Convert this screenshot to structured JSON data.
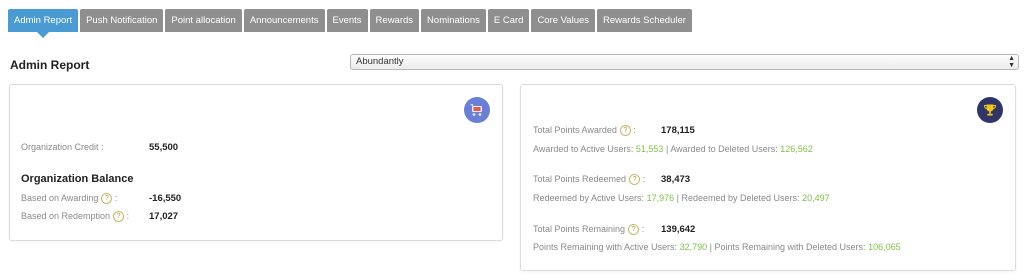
{
  "tabs": [
    {
      "label": "Admin Report",
      "active": true
    },
    {
      "label": "Push Notification",
      "active": false
    },
    {
      "label": "Point allocation",
      "active": false
    },
    {
      "label": "Announcements",
      "active": false
    },
    {
      "label": "Events",
      "active": false
    },
    {
      "label": "Rewards",
      "active": false
    },
    {
      "label": "Nominations",
      "active": false
    },
    {
      "label": "E Card",
      "active": false
    },
    {
      "label": "Core Values",
      "active": false
    },
    {
      "label": "Rewards Scheduler",
      "active": false
    }
  ],
  "colors": {
    "active_tab": "#4a9ad4",
    "inactive_tab": "#8f8f8f",
    "green_value": "#7fc24a"
  },
  "page_title": "Admin Report",
  "select": {
    "value": "Abundantly"
  },
  "left_card": {
    "icon": "shopping-cart-icon",
    "org_credit_label": "Organization Credit :",
    "org_credit_value": "55,500",
    "balance_title": "Organization Balance",
    "awarding_label": "Based on Awarding",
    "awarding_value": "-16,550",
    "redemption_label": "Based on Redemption",
    "redemption_value": "17,027"
  },
  "right_card": {
    "icon": "trophy-icon",
    "awarded_label": "Total Points Awarded",
    "awarded_value": "178,115",
    "awarded_active_label": "Awarded to Active Users:",
    "awarded_active_value": "51,553",
    "awarded_deleted_label": "Awarded to Deleted Users:",
    "awarded_deleted_value": "126,562",
    "redeemed_label": "Total Points Redeemed",
    "redeemed_value": "38,473",
    "redeemed_active_label": "Redeemed by Active Users:",
    "redeemed_active_value": "17,976",
    "redeemed_deleted_label": "Redeemed by Deleted Users:",
    "redeemed_deleted_value": "20,497",
    "remaining_label": "Total Points Remaining",
    "remaining_value": "139,642",
    "remaining_active_label": "Points Remaining with Active Users:",
    "remaining_active_value": "32,790",
    "remaining_deleted_label": "Points Remaining with Deleted Users:",
    "remaining_deleted_value": "106,065"
  },
  "help_glyph": "?",
  "colon": ":",
  "separator": "|"
}
